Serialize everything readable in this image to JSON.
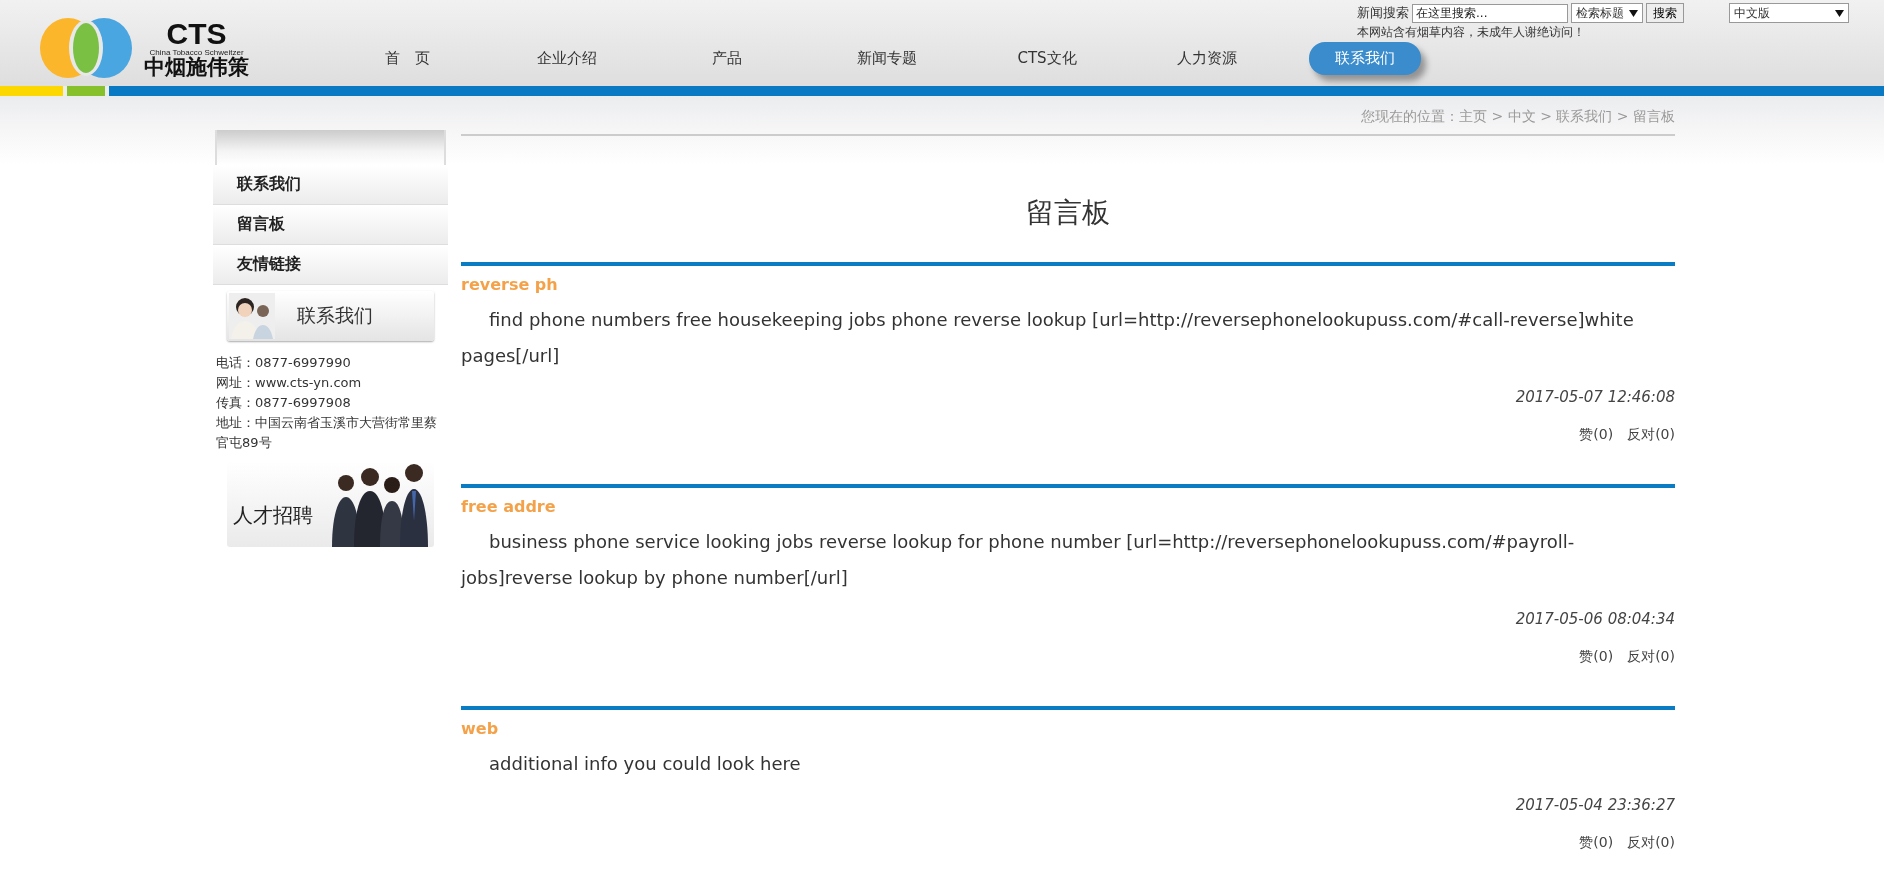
{
  "logo": {
    "mark": "CTS",
    "subtitle": "China Tobacco Schweitzer",
    "name": "中烟施伟策"
  },
  "search": {
    "label": "新闻搜索",
    "placeholder": "在这里搜索...",
    "scope": "检索标题",
    "button": "搜索",
    "language": "中文版",
    "notice": "本网站含有烟草内容，未成年人谢绝访问！"
  },
  "nav": [
    {
      "label": "首　页",
      "selected": false
    },
    {
      "label": "企业介绍",
      "selected": false
    },
    {
      "label": "产品",
      "selected": false
    },
    {
      "label": "新闻专题",
      "selected": false
    },
    {
      "label": "CTS文化",
      "selected": false
    },
    {
      "label": "人力资源",
      "selected": false
    },
    {
      "label": "联系我们",
      "selected": true
    }
  ],
  "sidebar": {
    "items": [
      {
        "label": "联系我们"
      },
      {
        "label": "留言板"
      },
      {
        "label": "友情链接"
      }
    ],
    "contact_banner": "联系我们",
    "contact": [
      "电话：0877-6997990",
      "网址：www.cts-yn.com",
      "传真：0877-6997908",
      "地址：中国云南省玉溪市大营街常里蔡官屯89号"
    ],
    "recruit_banner": "人才招聘"
  },
  "breadcrumb": "您现在的位置：主页 > 中文 > 联系我们 > 留言板",
  "page_title": "留言板",
  "messages": [
    {
      "author": "reverse ph",
      "body": "find phone numbers free housekeeping jobs phone reverse lookup [url=http://reversephonelookupuss.com/#call-reverse]white pages[/url]",
      "date": "2017-05-07 12:46:08",
      "like": "赞(0)",
      "oppose": "反对(0)"
    },
    {
      "author": "free addre",
      "body": "business phone service looking jobs reverse lookup for phone number [url=http://reversephonelookupuss.com/#payroll-jobs]reverse lookup by phone number[/url]",
      "date": "2017-05-06 08:04:34",
      "like": "赞(0)",
      "oppose": "反对(0)"
    },
    {
      "author": "web",
      "body": "additional info you could look here",
      "date": "2017-05-04 23:36:27",
      "like": "赞(0)",
      "oppose": "反对(0)"
    }
  ]
}
